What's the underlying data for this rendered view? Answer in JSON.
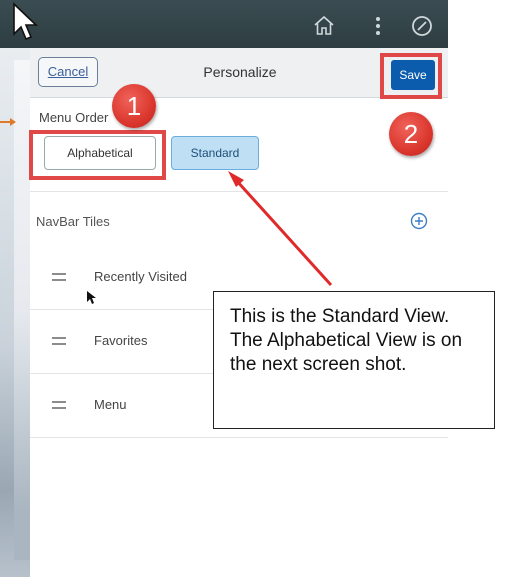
{
  "header": {
    "home_icon": "home-icon",
    "menu_icon": "vertical-dots-icon",
    "nav_icon": "navigation-compass-icon"
  },
  "panel": {
    "cancel_label": "Cancel",
    "title": "Personalize",
    "save_label": "Save",
    "menu_order_label": "Menu Order",
    "menu_order_options": [
      "Alphabetical",
      "Standard"
    ],
    "menu_order_selected": "Standard",
    "navbar_tiles_label": "NavBar Tiles",
    "tiles": [
      {
        "label": "Recently Visited"
      },
      {
        "label": "Favorites"
      },
      {
        "label": "Menu"
      }
    ]
  },
  "annotations": {
    "badge_1": "1",
    "badge_2": "2",
    "callout_text": "This is the Standard View. The Alphabetical View is on the next screen shot.",
    "accent_color": "#e04848"
  }
}
